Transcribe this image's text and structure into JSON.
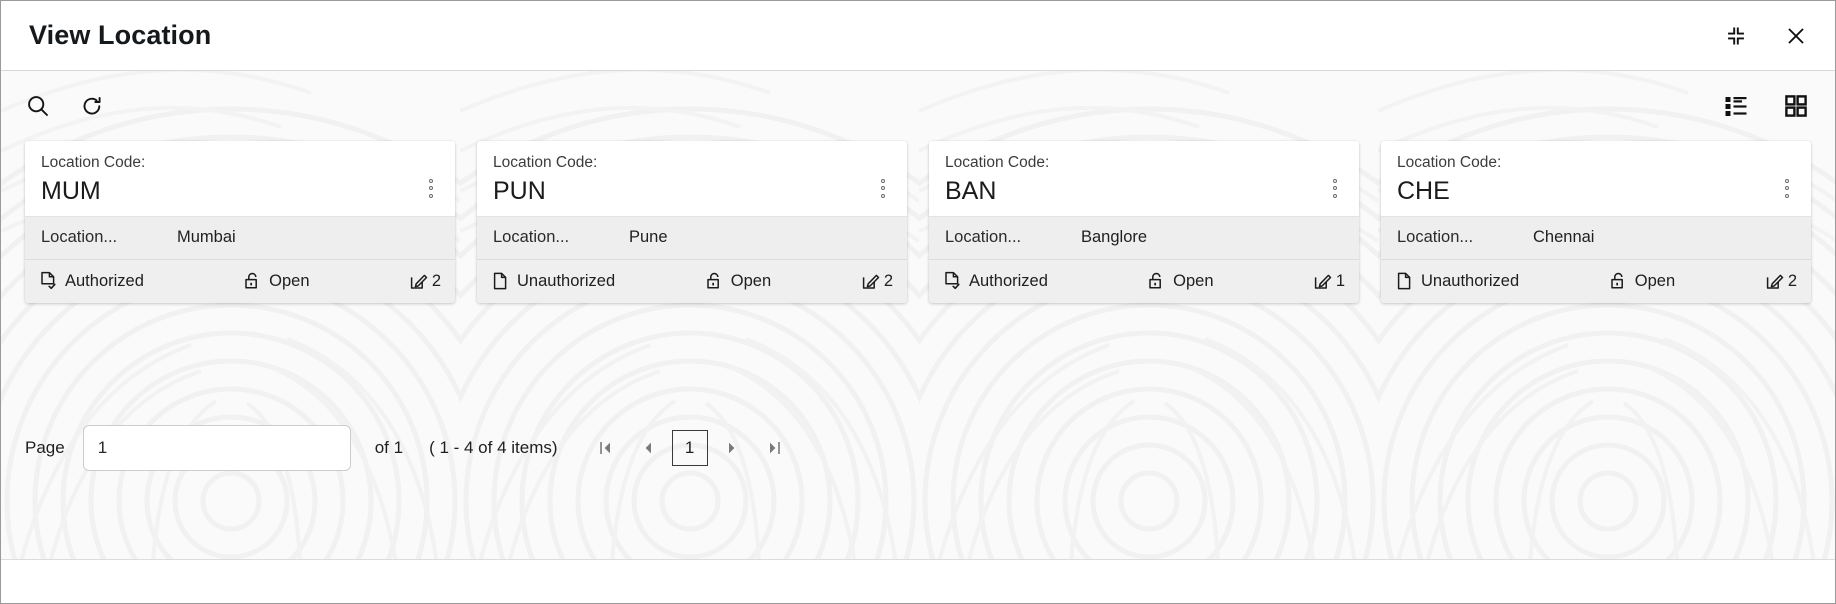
{
  "window": {
    "title": "View Location",
    "restore_icon": "restore-down-icon",
    "close_icon": "close-icon"
  },
  "toolbar": {
    "search_icon": "search-icon",
    "refresh_icon": "refresh-icon",
    "list_view_icon": "list-view-icon",
    "grid_view_icon": "grid-view-icon"
  },
  "cards": {
    "code_label": "Location Code:",
    "row_label": "Location...",
    "menu_icon": "more-options-icon",
    "items": [
      {
        "code": "MUM",
        "location_name": "Mumbai",
        "auth_status": "Authorized",
        "auth_icon": "document-check-icon",
        "lock_status": "Open",
        "lock_icon": "unlock-icon",
        "edit_icon": "edit-square-icon",
        "edit_count": "2"
      },
      {
        "code": "PUN",
        "location_name": "Pune",
        "auth_status": "Unauthorized",
        "auth_icon": "document-icon",
        "lock_status": "Open",
        "lock_icon": "unlock-icon",
        "edit_icon": "edit-square-icon",
        "edit_count": "2"
      },
      {
        "code": "BAN",
        "location_name": "Banglore",
        "auth_status": "Authorized",
        "auth_icon": "document-check-icon",
        "lock_status": "Open",
        "lock_icon": "unlock-icon",
        "edit_icon": "edit-square-icon",
        "edit_count": "1"
      },
      {
        "code": "CHE",
        "location_name": "Chennai",
        "auth_status": "Unauthorized",
        "auth_icon": "document-icon",
        "lock_status": "Open",
        "lock_icon": "unlock-icon",
        "edit_icon": "edit-square-icon",
        "edit_count": "2"
      }
    ]
  },
  "pager": {
    "label": "Page",
    "input_value": "1",
    "input_placeholder": "1",
    "of_text": "of 1",
    "items_text": "( 1 - 4 of 4 items)",
    "first_icon": "first-page-icon",
    "prev_icon": "previous-page-icon",
    "current_page": "1",
    "next_icon": "next-page-icon",
    "last_icon": "last-page-icon"
  },
  "colors": {
    "window_bg": "#ffffff",
    "body_bg": "#fafafa",
    "card_row_bg": "#eeeeee",
    "card_foot_bg": "#efefef",
    "text": "#1f1f1f"
  }
}
